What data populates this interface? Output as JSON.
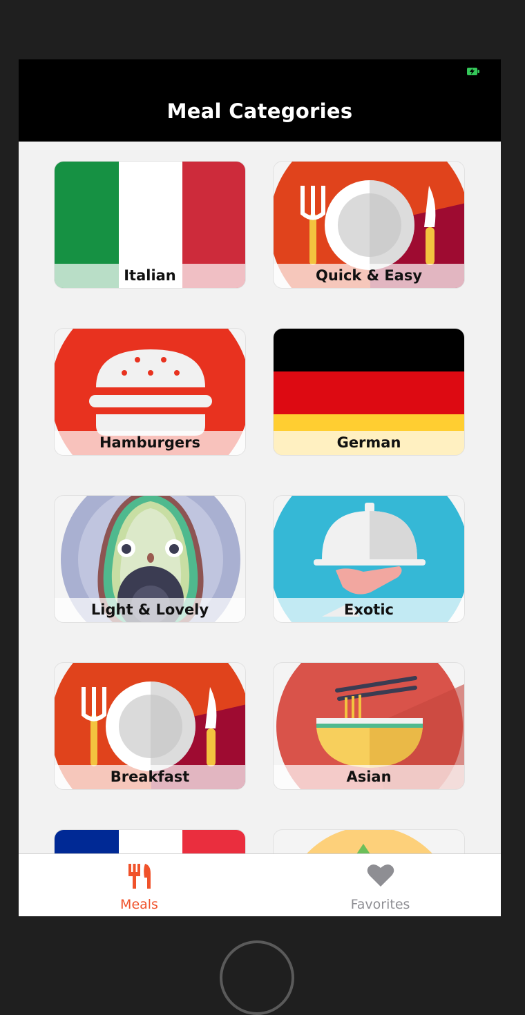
{
  "navbar": {
    "title": "Meal Categories"
  },
  "categories": [
    {
      "label": "Italian"
    },
    {
      "label": "Quick & Easy"
    },
    {
      "label": "Hamburgers"
    },
    {
      "label": "German"
    },
    {
      "label": "Light & Lovely"
    },
    {
      "label": "Exotic"
    },
    {
      "label": "Breakfast"
    },
    {
      "label": "Asian"
    },
    {
      "label": ""
    },
    {
      "label": ""
    }
  ],
  "tabbar": {
    "tabs": [
      {
        "label": "Meals",
        "icon": "fork-knife-icon",
        "active": true
      },
      {
        "label": "Favorites",
        "icon": "heart-icon",
        "active": false
      }
    ]
  },
  "colors": {
    "accent": "#f0522a",
    "inactive_tab": "#8e8e93",
    "navbar": "#000000"
  }
}
